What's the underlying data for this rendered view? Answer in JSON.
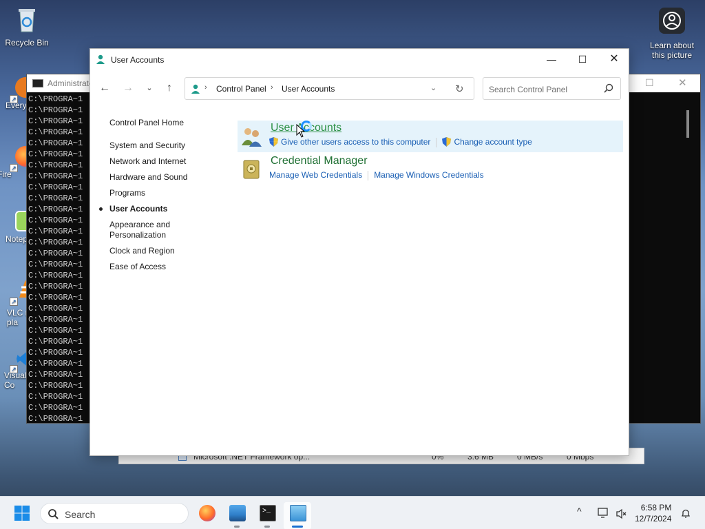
{
  "desktop": {
    "recycle_bin": "Recycle Bin",
    "learn_picture": "Learn about\nthis picture",
    "partial_icons": [
      "Every",
      "Fire",
      "Notep",
      "VLC m\npla",
      "Visual\nCo"
    ]
  },
  "console": {
    "title": "Administrato",
    "lines": [
      "C:\\PROGRA~1",
      "C:\\PROGRA~1",
      "C:\\PROGRA~1",
      "C:\\PROGRA~1",
      "C:\\PROGRA~1",
      "C:\\PROGRA~1",
      "C:\\PROGRA~1",
      "C:\\PROGRA~1",
      "C:\\PROGRA~1",
      "C:\\PROGRA~1",
      "C:\\PROGRA~1",
      "C:\\PROGRA~1",
      "C:\\PROGRA~1",
      "C:\\PROGRA~1",
      "C:\\PROGRA~1",
      "C:\\PROGRA~1",
      "C:\\PROGRA~1",
      "C:\\PROGRA~1",
      "C:\\PROGRA~1",
      "C:\\PROGRA~1",
      "C:\\PROGRA~1",
      "C:\\PROGRA~1",
      "C:\\PROGRA~1",
      "C:\\PROGRA~1",
      "C:\\PROGRA~1",
      "C:\\PROGRA~1",
      "C:\\PROGRA~1",
      "C:\\PROGRA~1",
      "C:\\PROGRA~1",
      "C:\\PROGRA~1"
    ]
  },
  "taskmgr_strip": {
    "process": "Microsoft .NET Framework op...",
    "cpu": "0%",
    "memory": "3.6 MB",
    "disk": "0 MB/s",
    "network": "0 Mbps"
  },
  "window": {
    "title": "User Accounts",
    "address": {
      "crumbs": [
        "Control Panel",
        "User Accounts"
      ]
    },
    "search_placeholder": "Search Control Panel",
    "sidebar": {
      "home": "Control Panel Home",
      "items": [
        "System and Security",
        "Network and Internet",
        "Hardware and Sound",
        "Programs",
        "User Accounts",
        "Appearance and\nPersonalization",
        "Clock and Region",
        "Ease of Access"
      ],
      "current_index": 4
    },
    "categories": [
      {
        "title": "User Accounts",
        "links": [
          "Give other users access to this computer",
          "Change account type"
        ]
      },
      {
        "title": "Credential Manager",
        "links": [
          "Manage Web Credentials",
          "Manage Windows Credentials"
        ]
      }
    ]
  },
  "taskbar": {
    "search_label": "Search",
    "time": "6:58 PM",
    "date": "12/7/2024"
  },
  "colors": {
    "link": "#1a5fb4",
    "category_title": "#1e6f32",
    "hover_bg": "#e5f3fb",
    "active_indicator": "#1a6fd0"
  }
}
